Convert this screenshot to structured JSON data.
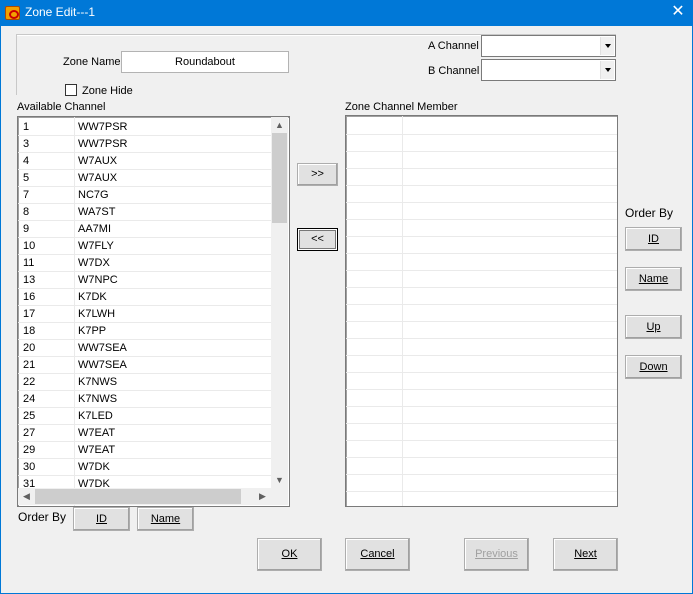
{
  "window": {
    "title": "Zone Edit---1",
    "close_glyph": "✕"
  },
  "zone": {
    "name_label": "Zone Name",
    "name_value": "Roundabout",
    "hide_label": "Zone Hide",
    "hide_checked": false
  },
  "channels": {
    "a_label": "A Channel",
    "a_value": "",
    "b_label": "B Channel",
    "b_value": ""
  },
  "available": {
    "label": "Available Channel",
    "rows": [
      {
        "id": "1",
        "name": "WW7PSR"
      },
      {
        "id": "3",
        "name": "WW7PSR"
      },
      {
        "id": "4",
        "name": "W7AUX"
      },
      {
        "id": "5",
        "name": "W7AUX"
      },
      {
        "id": "7",
        "name": "NC7G"
      },
      {
        "id": "8",
        "name": "WA7ST"
      },
      {
        "id": "9",
        "name": "AA7MI"
      },
      {
        "id": "10",
        "name": "W7FLY"
      },
      {
        "id": "11",
        "name": "W7DX"
      },
      {
        "id": "13",
        "name": "W7NPC"
      },
      {
        "id": "16",
        "name": "K7DK"
      },
      {
        "id": "17",
        "name": "K7LWH"
      },
      {
        "id": "18",
        "name": "K7PP"
      },
      {
        "id": "20",
        "name": "WW7SEA"
      },
      {
        "id": "21",
        "name": "WW7SEA"
      },
      {
        "id": "22",
        "name": "K7NWS"
      },
      {
        "id": "24",
        "name": "K7NWS"
      },
      {
        "id": "25",
        "name": "K7LED"
      },
      {
        "id": "27",
        "name": "W7EAT"
      },
      {
        "id": "29",
        "name": "W7EAT"
      },
      {
        "id": "30",
        "name": "W7DK"
      },
      {
        "id": "31",
        "name": "W7DK"
      }
    ]
  },
  "member": {
    "label": "Zone Channel Member"
  },
  "transfer": {
    "add": ">>",
    "remove": "<<"
  },
  "order_right": {
    "label": "Order By",
    "id_btn": "ID",
    "name_btn": "Name",
    "up_btn": "Up",
    "down_btn": "Down"
  },
  "order_bottom": {
    "label": "Order By",
    "id_btn": "ID",
    "name_btn": "Name"
  },
  "footer": {
    "ok": "OK",
    "cancel": "Cancel",
    "previous": "Previous",
    "next": "Next"
  },
  "scroll": {
    "up": "▲",
    "down": "▼",
    "left": "◀",
    "right": "▶"
  }
}
